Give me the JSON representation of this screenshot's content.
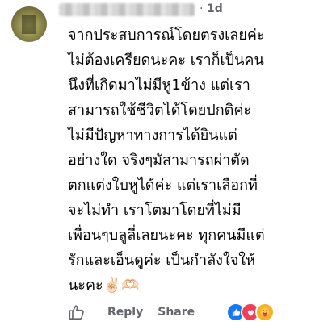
{
  "comment": {
    "timestamp": "1d",
    "dot": "·",
    "lines": [
      "จากประสบการณ์โดยตรงเลยค่ะ",
      "ไม่ต้องเครียดนะคะ เราก็เป็นคน",
      "นึงที่เกิดมาไม่มีหู1ข้าง แต่เรา",
      "สามารถใช้ชีวิตได้โดยปกติค่ะ",
      "ไม่มีปัญหาทางการได้ยินแต่",
      "อย่างใด จริงๆมัสามารถผ่าตัด",
      "ตกแต่งใบหูได้ค่ะ แต่เราเลือกที่",
      "จะไม่ทำ เราโตมาโดยที่ไม่มี",
      "เพื่อนๆบลูลี่เลยนะคะ ทุกคนมีแต่",
      "รักและเอ็นดูค่ะ เป็นกำลังใจให้",
      "นะคะ✌🏻🫶🏻"
    ]
  },
  "actions": {
    "reply_label": "Reply",
    "share_label": "Share"
  },
  "icons": {
    "like": "thumbs-up-outline-icon",
    "reactions": [
      "like-reaction-icon",
      "love-reaction-icon",
      "care-reaction-icon"
    ]
  },
  "colors": {
    "text": "#050505",
    "meta": "#65676b",
    "like_blue": "#1877f2",
    "love_red": "#f33e58",
    "care_yellow": "#f7b125"
  }
}
